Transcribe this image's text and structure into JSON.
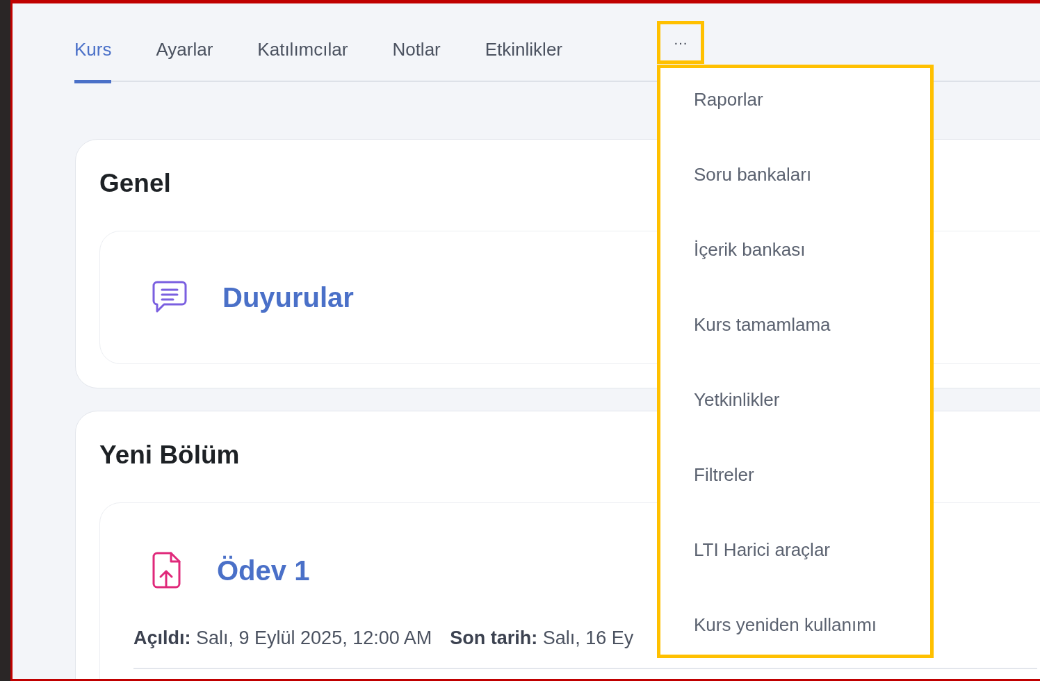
{
  "tabs": [
    {
      "label": "Kurs",
      "selected": true
    },
    {
      "label": "Ayarlar",
      "selected": false
    },
    {
      "label": "Katılımcılar",
      "selected": false
    },
    {
      "label": "Notlar",
      "selected": false
    },
    {
      "label": "Etkinlikler",
      "selected": false
    }
  ],
  "more_button": {
    "label": "···",
    "highlighted": true
  },
  "more_menu": {
    "highlighted": true,
    "items": [
      {
        "label": "Raporlar"
      },
      {
        "label": "Soru bankaları"
      },
      {
        "label": "İçerik bankası"
      },
      {
        "label": "Kurs tamamlama"
      },
      {
        "label": "Yetkinlikler"
      },
      {
        "label": "Filtreler"
      },
      {
        "label": "LTI Harici araçlar"
      },
      {
        "label": "Kurs yeniden kullanımı"
      }
    ]
  },
  "sections": [
    {
      "title": "Genel",
      "activities": [
        {
          "kind": "forum",
          "name": "Duyurular"
        }
      ]
    },
    {
      "title": "Yeni Bölüm",
      "activities": [
        {
          "kind": "assignment",
          "name": "Ödev 1",
          "dates": [
            {
              "label": "Açıldı:",
              "value": "Salı, 9 Eylül 2025, 12:00 AM"
            },
            {
              "label": "Son tarih:",
              "value": "Salı, 16 Ey"
            }
          ]
        }
      ]
    }
  ]
}
